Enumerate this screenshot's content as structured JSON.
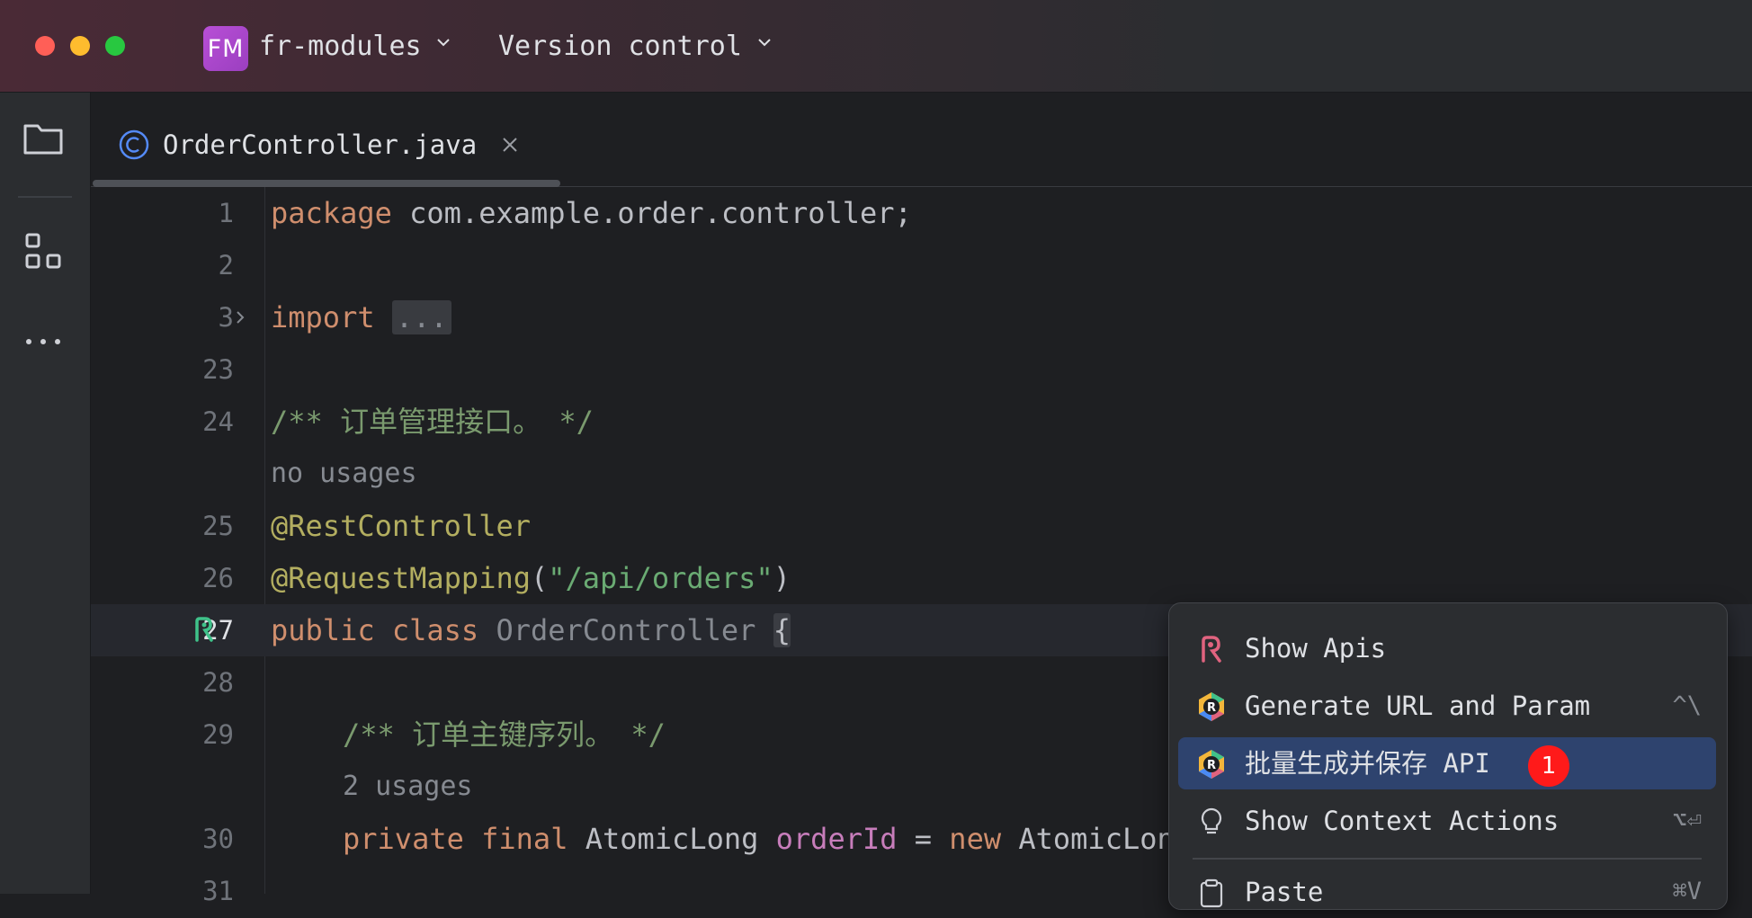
{
  "window": {
    "project_badge": "FM",
    "project_name": "fr-modules",
    "vcs_label": "Version control"
  },
  "tab": {
    "file_name": "OrderController.java"
  },
  "editor": {
    "lines": [
      {
        "num": "1"
      },
      {
        "num": "2"
      },
      {
        "num": "3"
      },
      {
        "num": "23"
      },
      {
        "num": "24"
      },
      {
        "num": ""
      },
      {
        "num": "25"
      },
      {
        "num": "26"
      },
      {
        "num": "27"
      },
      {
        "num": "28"
      },
      {
        "num": "29"
      },
      {
        "num": ""
      },
      {
        "num": "30"
      },
      {
        "num": "31"
      }
    ],
    "tokens": {
      "l1_kw": "package",
      "l1_rest": " com.example.order.controller;",
      "l3_kw": "import",
      "l3_fold": "...",
      "l24_comment": "/** 订单管理接口。 */",
      "usage1": "no usages",
      "l25_ann": "@RestController",
      "l26_ann": "@RequestMapping",
      "l26_open": "(",
      "l26_str": "\"/api/orders\"",
      "l26_close": ")",
      "l27_kw1": "public",
      "l27_kw2": "class",
      "l27_name": "OrderController",
      "l27_brace": "{",
      "l29_comment": "/** 订单主键序列。 */",
      "usage2": "2 usages",
      "l30_kw1": "private",
      "l30_kw2": "final",
      "l30_type": "AtomicLong",
      "l30_field": "orderId",
      "l30_eq": " = ",
      "l30_new": "new",
      "l30_rest": " AtomicLong"
    }
  },
  "context_menu": {
    "items": [
      {
        "label": "Show Apis",
        "shortcut": ""
      },
      {
        "label": "Generate URL and Param",
        "shortcut": "^\\"
      },
      {
        "label": "批量生成并保存 API",
        "shortcut": "",
        "badge": "1"
      },
      {
        "label": "Show Context Actions",
        "shortcut": "⌥⏎"
      },
      {
        "label": "Paste",
        "shortcut": "⌘V"
      }
    ]
  },
  "colors": {
    "accent_selected": "#2e436e",
    "badge_red": "#ff1a1a",
    "keyword": "#cf8e6d",
    "annotation": "#b3ae60",
    "string": "#6aab73"
  },
  "icons": {
    "sidebar": [
      "folder-icon",
      "structure-icon",
      "more-icon"
    ],
    "tab": "java-class-icon",
    "menu": [
      "show-apis-icon",
      "restful-plugin-icon",
      "restful-plugin-icon",
      "lightbulb-icon",
      "clipboard-icon"
    ]
  }
}
